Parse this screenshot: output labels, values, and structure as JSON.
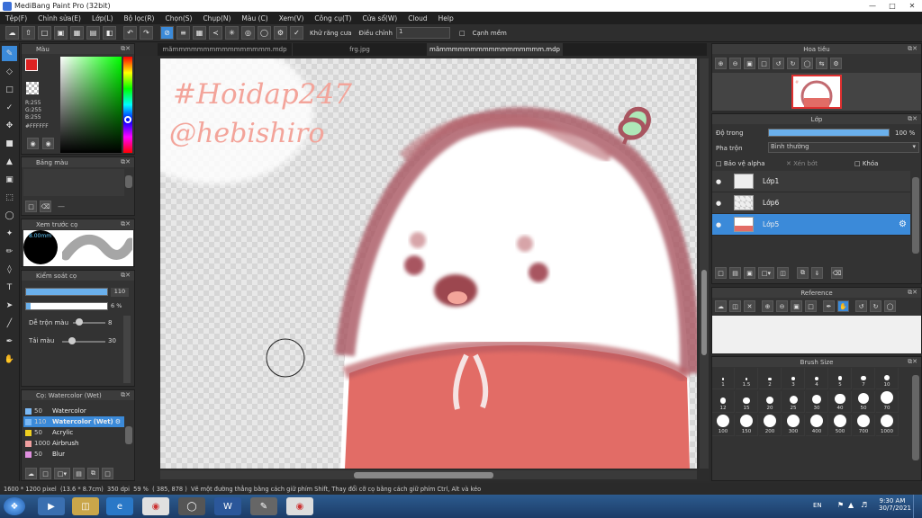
{
  "window": {
    "title": "MediBang Paint Pro (32bit)"
  },
  "menu": [
    "Tệp(F)",
    "Chỉnh sửa(E)",
    "Lớp(L)",
    "Bộ lọc(R)",
    "Chọn(S)",
    "Chụp(N)",
    "Màu (C)",
    "Xem(V)",
    "Công cụ(T)",
    "Cửa sổ(W)",
    "Cloud",
    "Help"
  ],
  "toolbar": {
    "antialias_label": "Khử răng cưa",
    "correction_label": "Điều chỉnh",
    "correction_value": "1",
    "snap_label": "Cạnh mềm"
  },
  "tabs": [
    "mãmmmmmmmmmmmmmmmm.mdp",
    "frg.jpg",
    "mãmmmmmmmmmmmmmmmmm.mdp"
  ],
  "color_panel": {
    "title": "Màu",
    "r": "R:255",
    "g": "G:255",
    "b": "B:255",
    "hex": "#FFFFFF",
    "accent": "#3b8ad9"
  },
  "palette_panel": {
    "title": "Bảng màu"
  },
  "brush_preview": {
    "title": "Xem trước cọ",
    "size_label": "8.00mm"
  },
  "brush_control": {
    "title": "Kiểm soát cọ",
    "size_value": "110",
    "opacity_value": "6 %",
    "blend_label": "Dễ trộn màu",
    "blend_value": "8",
    "dilution_label": "Tải màu",
    "dilution_value": "30"
  },
  "brush_list": {
    "title": "Cọ: Watercolor (Wet)",
    "items": [
      {
        "size": "50",
        "name": "Watercolor",
        "color": "#7ab8f5"
      },
      {
        "size": "110",
        "name": "Watercolor (Wet)",
        "color": "#7ab8f5"
      },
      {
        "size": "50",
        "name": "Acrylic",
        "color": "#f0d020"
      },
      {
        "size": "1000",
        "name": "Airbrush",
        "color": "#f0a0a0"
      },
      {
        "size": "50",
        "name": "Blur",
        "color": "#e090e0"
      }
    ],
    "selected_index": 1
  },
  "canvas_text": {
    "line1": "#Hoidap247",
    "line2": "@hebishiro"
  },
  "navigator": {
    "title": "Hoa tiêu"
  },
  "layers": {
    "title": "Lớp",
    "opacity_label": "Độ trong",
    "opacity_value": "100 %",
    "opacity_fraction": 1.0,
    "blend_label": "Pha trộn",
    "blend_value": "Bình thường",
    "protect_alpha": "Bảo vệ alpha",
    "clipping": "Xén bớt",
    "lock": "Khóa",
    "rows": [
      "Lớp1",
      "Lớp6",
      "Lớp5"
    ],
    "selected_index": 2
  },
  "reference": {
    "title": "Reference"
  },
  "brush_size": {
    "title": "Brush Size",
    "sizes": [
      "1",
      "1.5",
      "2",
      "3",
      "4",
      "5",
      "7",
      "10",
      "12",
      "15",
      "20",
      "25",
      "30",
      "40",
      "50",
      "70",
      "100",
      "150",
      "200",
      "300",
      "400",
      "500",
      "700",
      "1000"
    ]
  },
  "status": {
    "dims": "1600 * 1200 pixel",
    "physical": "(13.6 * 8.7cm)",
    "dpi": "350 dpi",
    "zoom": "59 %",
    "coords": "( 385, 878 )",
    "hint": "Vẽ một đường thẳng bằng cách giữ phím Shift, Thay đổi cỡ cọ bằng cách giữ phím Ctrl, Alt và kéo"
  },
  "taskbar": {
    "lang": "EN",
    "time": "9:30 AM",
    "date": "30/7/2021"
  }
}
